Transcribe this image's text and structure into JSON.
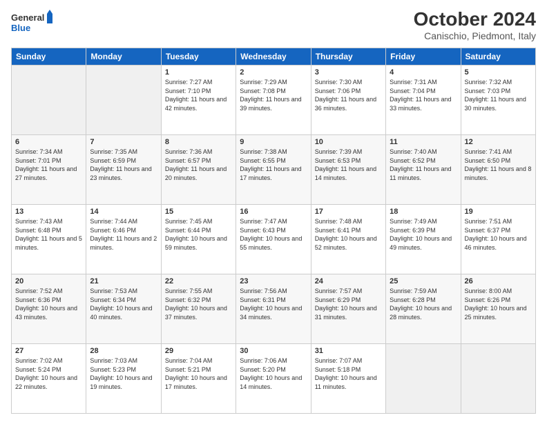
{
  "header": {
    "logo_general": "General",
    "logo_blue": "Blue",
    "title": "October 2024",
    "subtitle": "Canischio, Piedmont, Italy"
  },
  "days_of_week": [
    "Sunday",
    "Monday",
    "Tuesday",
    "Wednesday",
    "Thursday",
    "Friday",
    "Saturday"
  ],
  "weeks": [
    [
      {
        "day": "",
        "info": ""
      },
      {
        "day": "",
        "info": ""
      },
      {
        "day": "1",
        "info": "Sunrise: 7:27 AM\nSunset: 7:10 PM\nDaylight: 11 hours and 42 minutes."
      },
      {
        "day": "2",
        "info": "Sunrise: 7:29 AM\nSunset: 7:08 PM\nDaylight: 11 hours and 39 minutes."
      },
      {
        "day": "3",
        "info": "Sunrise: 7:30 AM\nSunset: 7:06 PM\nDaylight: 11 hours and 36 minutes."
      },
      {
        "day": "4",
        "info": "Sunrise: 7:31 AM\nSunset: 7:04 PM\nDaylight: 11 hours and 33 minutes."
      },
      {
        "day": "5",
        "info": "Sunrise: 7:32 AM\nSunset: 7:03 PM\nDaylight: 11 hours and 30 minutes."
      }
    ],
    [
      {
        "day": "6",
        "info": "Sunrise: 7:34 AM\nSunset: 7:01 PM\nDaylight: 11 hours and 27 minutes."
      },
      {
        "day": "7",
        "info": "Sunrise: 7:35 AM\nSunset: 6:59 PM\nDaylight: 11 hours and 23 minutes."
      },
      {
        "day": "8",
        "info": "Sunrise: 7:36 AM\nSunset: 6:57 PM\nDaylight: 11 hours and 20 minutes."
      },
      {
        "day": "9",
        "info": "Sunrise: 7:38 AM\nSunset: 6:55 PM\nDaylight: 11 hours and 17 minutes."
      },
      {
        "day": "10",
        "info": "Sunrise: 7:39 AM\nSunset: 6:53 PM\nDaylight: 11 hours and 14 minutes."
      },
      {
        "day": "11",
        "info": "Sunrise: 7:40 AM\nSunset: 6:52 PM\nDaylight: 11 hours and 11 minutes."
      },
      {
        "day": "12",
        "info": "Sunrise: 7:41 AM\nSunset: 6:50 PM\nDaylight: 11 hours and 8 minutes."
      }
    ],
    [
      {
        "day": "13",
        "info": "Sunrise: 7:43 AM\nSunset: 6:48 PM\nDaylight: 11 hours and 5 minutes."
      },
      {
        "day": "14",
        "info": "Sunrise: 7:44 AM\nSunset: 6:46 PM\nDaylight: 11 hours and 2 minutes."
      },
      {
        "day": "15",
        "info": "Sunrise: 7:45 AM\nSunset: 6:44 PM\nDaylight: 10 hours and 59 minutes."
      },
      {
        "day": "16",
        "info": "Sunrise: 7:47 AM\nSunset: 6:43 PM\nDaylight: 10 hours and 55 minutes."
      },
      {
        "day": "17",
        "info": "Sunrise: 7:48 AM\nSunset: 6:41 PM\nDaylight: 10 hours and 52 minutes."
      },
      {
        "day": "18",
        "info": "Sunrise: 7:49 AM\nSunset: 6:39 PM\nDaylight: 10 hours and 49 minutes."
      },
      {
        "day": "19",
        "info": "Sunrise: 7:51 AM\nSunset: 6:37 PM\nDaylight: 10 hours and 46 minutes."
      }
    ],
    [
      {
        "day": "20",
        "info": "Sunrise: 7:52 AM\nSunset: 6:36 PM\nDaylight: 10 hours and 43 minutes."
      },
      {
        "day": "21",
        "info": "Sunrise: 7:53 AM\nSunset: 6:34 PM\nDaylight: 10 hours and 40 minutes."
      },
      {
        "day": "22",
        "info": "Sunrise: 7:55 AM\nSunset: 6:32 PM\nDaylight: 10 hours and 37 minutes."
      },
      {
        "day": "23",
        "info": "Sunrise: 7:56 AM\nSunset: 6:31 PM\nDaylight: 10 hours and 34 minutes."
      },
      {
        "day": "24",
        "info": "Sunrise: 7:57 AM\nSunset: 6:29 PM\nDaylight: 10 hours and 31 minutes."
      },
      {
        "day": "25",
        "info": "Sunrise: 7:59 AM\nSunset: 6:28 PM\nDaylight: 10 hours and 28 minutes."
      },
      {
        "day": "26",
        "info": "Sunrise: 8:00 AM\nSunset: 6:26 PM\nDaylight: 10 hours and 25 minutes."
      }
    ],
    [
      {
        "day": "27",
        "info": "Sunrise: 7:02 AM\nSunset: 5:24 PM\nDaylight: 10 hours and 22 minutes."
      },
      {
        "day": "28",
        "info": "Sunrise: 7:03 AM\nSunset: 5:23 PM\nDaylight: 10 hours and 19 minutes."
      },
      {
        "day": "29",
        "info": "Sunrise: 7:04 AM\nSunset: 5:21 PM\nDaylight: 10 hours and 17 minutes."
      },
      {
        "day": "30",
        "info": "Sunrise: 7:06 AM\nSunset: 5:20 PM\nDaylight: 10 hours and 14 minutes."
      },
      {
        "day": "31",
        "info": "Sunrise: 7:07 AM\nSunset: 5:18 PM\nDaylight: 10 hours and 11 minutes."
      },
      {
        "day": "",
        "info": ""
      },
      {
        "day": "",
        "info": ""
      }
    ]
  ]
}
